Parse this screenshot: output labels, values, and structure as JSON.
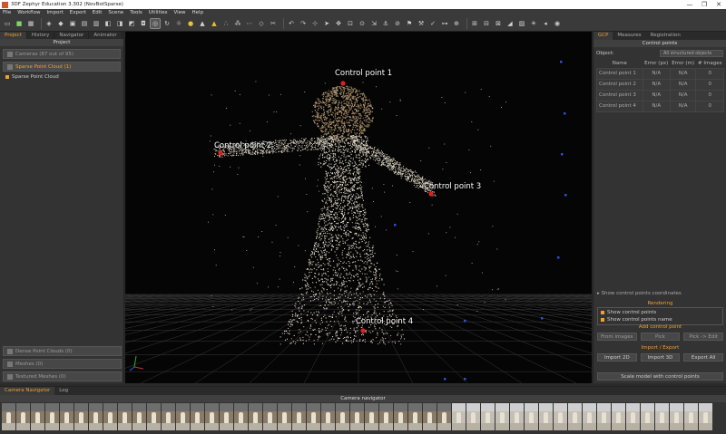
{
  "window": {
    "title": "3DF Zephyr Education 3.302 (NovBotSparse)",
    "controls": [
      "—",
      "❐",
      "✕"
    ]
  },
  "menu": [
    "File",
    "Workflow",
    "Import",
    "Export",
    "Edit",
    "Scene",
    "Tools",
    "Utilities",
    "View",
    "Help"
  ],
  "left_panel": {
    "tabs": [
      "Project",
      "History",
      "Navigator",
      "Animator"
    ],
    "header": "Project",
    "cameras": "Cameras (87 out of 95)",
    "sparse_cloud": "Sparse Point Cloud (1)",
    "sparse_item": "Sparse Point Cloud",
    "dense": "Dense Point Clouds (0)",
    "meshes": "Meshes (0)",
    "textured": "Textured Meshes (0)"
  },
  "viewport": {
    "control_points": [
      {
        "label": "Control point 1"
      },
      {
        "label": "Control point 2"
      },
      {
        "label": "Control point 3"
      },
      {
        "label": "Control point 4"
      }
    ]
  },
  "right_panel": {
    "tabs": [
      "GCP",
      "Measures",
      "Registration"
    ],
    "header": "Control points",
    "object_label": "Object:",
    "object_value": "All structured objects",
    "columns": [
      "Name",
      "Error (px)",
      "Error (m)",
      "# Images"
    ],
    "rows": [
      [
        "Control point 1",
        "N/A",
        "N/A",
        "0"
      ],
      [
        "Control point 2",
        "N/A",
        "N/A",
        "0"
      ],
      [
        "Control point 3",
        "N/A",
        "N/A",
        "0"
      ],
      [
        "Control point 4",
        "N/A",
        "N/A",
        "0"
      ]
    ],
    "show_coords": "Show control points coordinates",
    "rendering_head": "Rendering",
    "show_points": "Show control points",
    "show_names": "Show control points name",
    "add_head": "Add control point",
    "from_images": "From images",
    "pick": "Pick",
    "pick_edit": "Pick -> Edit",
    "io_head": "Import / Export",
    "import_2d": "Import 2D",
    "import_3d": "Import 3D",
    "export_all": "Export All",
    "scale_btn": "Scale model with control points"
  },
  "bottom_panel": {
    "tabs": [
      "Camera Navigator",
      "Log"
    ],
    "header": "Camera navigator"
  },
  "colors": {
    "accent": "#f0a030",
    "control_point": "#e02020"
  }
}
